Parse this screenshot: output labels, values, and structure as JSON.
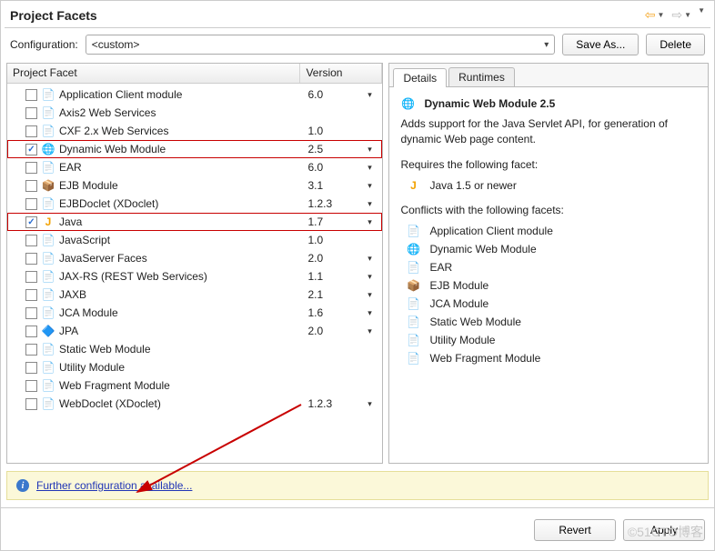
{
  "title": "Project Facets",
  "config_label": "Configuration:",
  "config_value": "<custom>",
  "save_as_label": "Save As...",
  "delete_label": "Delete",
  "col_facet": "Project Facet",
  "col_version": "Version",
  "facets": [
    {
      "name": "Application Client module",
      "ver": "6.0",
      "checked": false,
      "hasDrop": true,
      "icon": "doc"
    },
    {
      "name": "Axis2 Web Services",
      "ver": "",
      "checked": false,
      "hasDrop": false,
      "icon": "doc"
    },
    {
      "name": "CXF 2.x Web Services",
      "ver": "1.0",
      "checked": false,
      "hasDrop": false,
      "icon": "doc"
    },
    {
      "name": "Dynamic Web Module",
      "ver": "2.5",
      "checked": true,
      "hasDrop": true,
      "icon": "globe",
      "hl": true
    },
    {
      "name": "EAR",
      "ver": "6.0",
      "checked": false,
      "hasDrop": true,
      "icon": "doc"
    },
    {
      "name": "EJB Module",
      "ver": "3.1",
      "checked": false,
      "hasDrop": true,
      "icon": "box"
    },
    {
      "name": "EJBDoclet (XDoclet)",
      "ver": "1.2.3",
      "checked": false,
      "hasDrop": true,
      "icon": "doc"
    },
    {
      "name": "Java",
      "ver": "1.7",
      "checked": true,
      "hasDrop": true,
      "icon": "j",
      "hl": true
    },
    {
      "name": "JavaScript",
      "ver": "1.0",
      "checked": false,
      "hasDrop": false,
      "icon": "doc"
    },
    {
      "name": "JavaServer Faces",
      "ver": "2.0",
      "checked": false,
      "hasDrop": true,
      "icon": "doc"
    },
    {
      "name": "JAX-RS (REST Web Services)",
      "ver": "1.1",
      "checked": false,
      "hasDrop": true,
      "icon": "doc"
    },
    {
      "name": "JAXB",
      "ver": "2.1",
      "checked": false,
      "hasDrop": true,
      "icon": "doc"
    },
    {
      "name": "JCA Module",
      "ver": "1.6",
      "checked": false,
      "hasDrop": true,
      "icon": "doc"
    },
    {
      "name": "JPA",
      "ver": "2.0",
      "checked": false,
      "hasDrop": true,
      "icon": "db"
    },
    {
      "name": "Static Web Module",
      "ver": "",
      "checked": false,
      "hasDrop": false,
      "icon": "doc"
    },
    {
      "name": "Utility Module",
      "ver": "",
      "checked": false,
      "hasDrop": false,
      "icon": "doc"
    },
    {
      "name": "Web Fragment Module",
      "ver": "",
      "checked": false,
      "hasDrop": false,
      "icon": "doc"
    },
    {
      "name": "WebDoclet (XDoclet)",
      "ver": "1.2.3",
      "checked": false,
      "hasDrop": true,
      "icon": "doc"
    }
  ],
  "tabs": {
    "details": "Details",
    "runtimes": "Runtimes"
  },
  "details": {
    "title": "Dynamic Web Module 2.5",
    "desc": "Adds support for the Java Servlet API, for generation of dynamic Web page content.",
    "requires_label": "Requires the following facet:",
    "requires": [
      {
        "icon": "j",
        "text": "Java 1.5 or newer"
      }
    ],
    "conflicts_label": "Conflicts with the following facets:",
    "conflicts": [
      {
        "icon": "doc",
        "text": "Application Client module"
      },
      {
        "icon": "globe",
        "text": "Dynamic Web Module"
      },
      {
        "icon": "doc",
        "text": "EAR"
      },
      {
        "icon": "box",
        "text": "EJB Module"
      },
      {
        "icon": "doc",
        "text": "JCA Module"
      },
      {
        "icon": "doc",
        "text": "Static Web Module"
      },
      {
        "icon": "doc",
        "text": "Utility Module"
      },
      {
        "icon": "doc",
        "text": "Web Fragment Module"
      }
    ]
  },
  "info_link": "Further configuration available...",
  "revert_label": "Revert",
  "apply_label": "Apply"
}
